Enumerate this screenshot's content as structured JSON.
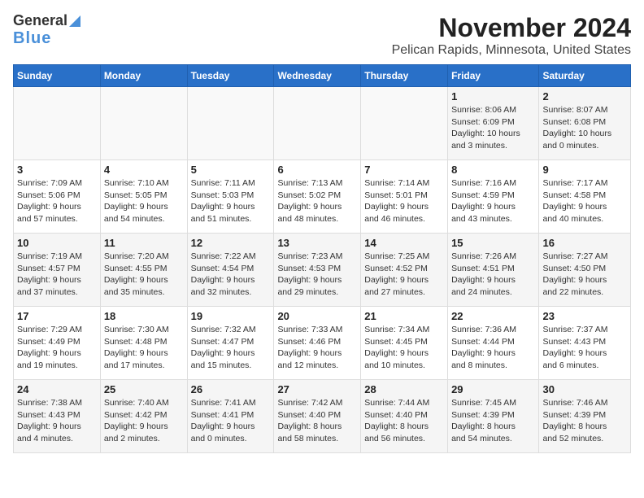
{
  "header": {
    "logo_line1": "General",
    "logo_line2": "Blue",
    "title": "November 2024",
    "subtitle": "Pelican Rapids, Minnesota, United States"
  },
  "days_of_week": [
    "Sunday",
    "Monday",
    "Tuesday",
    "Wednesday",
    "Thursday",
    "Friday",
    "Saturday"
  ],
  "weeks": [
    [
      {
        "day": "",
        "info": ""
      },
      {
        "day": "",
        "info": ""
      },
      {
        "day": "",
        "info": ""
      },
      {
        "day": "",
        "info": ""
      },
      {
        "day": "",
        "info": ""
      },
      {
        "day": "1",
        "info": "Sunrise: 8:06 AM\nSunset: 6:09 PM\nDaylight: 10 hours\nand 3 minutes."
      },
      {
        "day": "2",
        "info": "Sunrise: 8:07 AM\nSunset: 6:08 PM\nDaylight: 10 hours\nand 0 minutes."
      }
    ],
    [
      {
        "day": "3",
        "info": "Sunrise: 7:09 AM\nSunset: 5:06 PM\nDaylight: 9 hours\nand 57 minutes."
      },
      {
        "day": "4",
        "info": "Sunrise: 7:10 AM\nSunset: 5:05 PM\nDaylight: 9 hours\nand 54 minutes."
      },
      {
        "day": "5",
        "info": "Sunrise: 7:11 AM\nSunset: 5:03 PM\nDaylight: 9 hours\nand 51 minutes."
      },
      {
        "day": "6",
        "info": "Sunrise: 7:13 AM\nSunset: 5:02 PM\nDaylight: 9 hours\nand 48 minutes."
      },
      {
        "day": "7",
        "info": "Sunrise: 7:14 AM\nSunset: 5:01 PM\nDaylight: 9 hours\nand 46 minutes."
      },
      {
        "day": "8",
        "info": "Sunrise: 7:16 AM\nSunset: 4:59 PM\nDaylight: 9 hours\nand 43 minutes."
      },
      {
        "day": "9",
        "info": "Sunrise: 7:17 AM\nSunset: 4:58 PM\nDaylight: 9 hours\nand 40 minutes."
      }
    ],
    [
      {
        "day": "10",
        "info": "Sunrise: 7:19 AM\nSunset: 4:57 PM\nDaylight: 9 hours\nand 37 minutes."
      },
      {
        "day": "11",
        "info": "Sunrise: 7:20 AM\nSunset: 4:55 PM\nDaylight: 9 hours\nand 35 minutes."
      },
      {
        "day": "12",
        "info": "Sunrise: 7:22 AM\nSunset: 4:54 PM\nDaylight: 9 hours\nand 32 minutes."
      },
      {
        "day": "13",
        "info": "Sunrise: 7:23 AM\nSunset: 4:53 PM\nDaylight: 9 hours\nand 29 minutes."
      },
      {
        "day": "14",
        "info": "Sunrise: 7:25 AM\nSunset: 4:52 PM\nDaylight: 9 hours\nand 27 minutes."
      },
      {
        "day": "15",
        "info": "Sunrise: 7:26 AM\nSunset: 4:51 PM\nDaylight: 9 hours\nand 24 minutes."
      },
      {
        "day": "16",
        "info": "Sunrise: 7:27 AM\nSunset: 4:50 PM\nDaylight: 9 hours\nand 22 minutes."
      }
    ],
    [
      {
        "day": "17",
        "info": "Sunrise: 7:29 AM\nSunset: 4:49 PM\nDaylight: 9 hours\nand 19 minutes."
      },
      {
        "day": "18",
        "info": "Sunrise: 7:30 AM\nSunset: 4:48 PM\nDaylight: 9 hours\nand 17 minutes."
      },
      {
        "day": "19",
        "info": "Sunrise: 7:32 AM\nSunset: 4:47 PM\nDaylight: 9 hours\nand 15 minutes."
      },
      {
        "day": "20",
        "info": "Sunrise: 7:33 AM\nSunset: 4:46 PM\nDaylight: 9 hours\nand 12 minutes."
      },
      {
        "day": "21",
        "info": "Sunrise: 7:34 AM\nSunset: 4:45 PM\nDaylight: 9 hours\nand 10 minutes."
      },
      {
        "day": "22",
        "info": "Sunrise: 7:36 AM\nSunset: 4:44 PM\nDaylight: 9 hours\nand 8 minutes."
      },
      {
        "day": "23",
        "info": "Sunrise: 7:37 AM\nSunset: 4:43 PM\nDaylight: 9 hours\nand 6 minutes."
      }
    ],
    [
      {
        "day": "24",
        "info": "Sunrise: 7:38 AM\nSunset: 4:43 PM\nDaylight: 9 hours\nand 4 minutes."
      },
      {
        "day": "25",
        "info": "Sunrise: 7:40 AM\nSunset: 4:42 PM\nDaylight: 9 hours\nand 2 minutes."
      },
      {
        "day": "26",
        "info": "Sunrise: 7:41 AM\nSunset: 4:41 PM\nDaylight: 9 hours\nand 0 minutes."
      },
      {
        "day": "27",
        "info": "Sunrise: 7:42 AM\nSunset: 4:40 PM\nDaylight: 8 hours\nand 58 minutes."
      },
      {
        "day": "28",
        "info": "Sunrise: 7:44 AM\nSunset: 4:40 PM\nDaylight: 8 hours\nand 56 minutes."
      },
      {
        "day": "29",
        "info": "Sunrise: 7:45 AM\nSunset: 4:39 PM\nDaylight: 8 hours\nand 54 minutes."
      },
      {
        "day": "30",
        "info": "Sunrise: 7:46 AM\nSunset: 4:39 PM\nDaylight: 8 hours\nand 52 minutes."
      }
    ]
  ]
}
